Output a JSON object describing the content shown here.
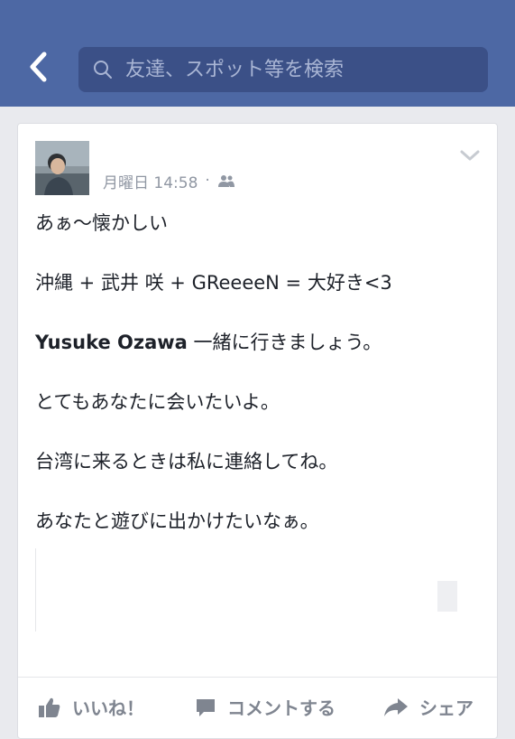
{
  "header": {
    "search_placeholder": "友達、スポット等を検索",
    "bar_color": "#4d68a4"
  },
  "post": {
    "timestamp": "月曜日 14:58",
    "separator": "·",
    "privacy_icon": "friends-icon",
    "lines": [
      "あぁ〜懐かしい",
      "沖縄 + 武井 咲 + GReeeeN = 大好き<3"
    ],
    "mention_name": "Yusuke Ozawa",
    "mention_text": " 一緒に行きましょう。",
    "lines_after": [
      "とてもあなたに会いたいよ。",
      "台湾に来るときは私に連絡してね。",
      "あなたと遊びに出かけたいなぁ。"
    ]
  },
  "actions": {
    "like": "いいね！",
    "comment": "コメントする",
    "share": "シェア"
  }
}
